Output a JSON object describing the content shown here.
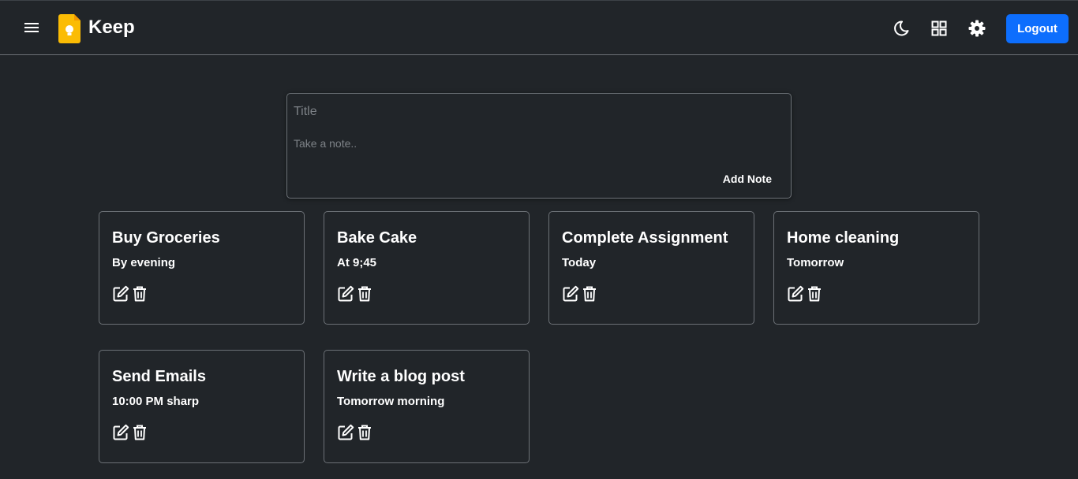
{
  "app": {
    "name": "Keep",
    "logo_color": "#fbbc04",
    "accent_color": "#0d6efd"
  },
  "navbar": {
    "menu_icon": "hamburger-menu-icon",
    "theme_icon": "moon-icon",
    "layout_icon": "grid-view-icon",
    "settings_icon": "gear-icon",
    "logout_label": "Logout"
  },
  "compose": {
    "title_placeholder": "Title",
    "note_placeholder": "Take a note..",
    "add_label": "Add Note"
  },
  "notes": [
    {
      "title": "Buy Groceries",
      "content": "By evening"
    },
    {
      "title": "Bake Cake",
      "content": "At 9;45"
    },
    {
      "title": "Complete Assignment",
      "content": "Today"
    },
    {
      "title": "Home cleaning",
      "content": "Tomorrow"
    },
    {
      "title": "Send Emails",
      "content": "10:00 PM sharp"
    },
    {
      "title": "Write a blog post",
      "content": "Tomorrow morning"
    }
  ],
  "note_actions": {
    "edit_icon": "edit-icon",
    "delete_icon": "trash-icon"
  }
}
